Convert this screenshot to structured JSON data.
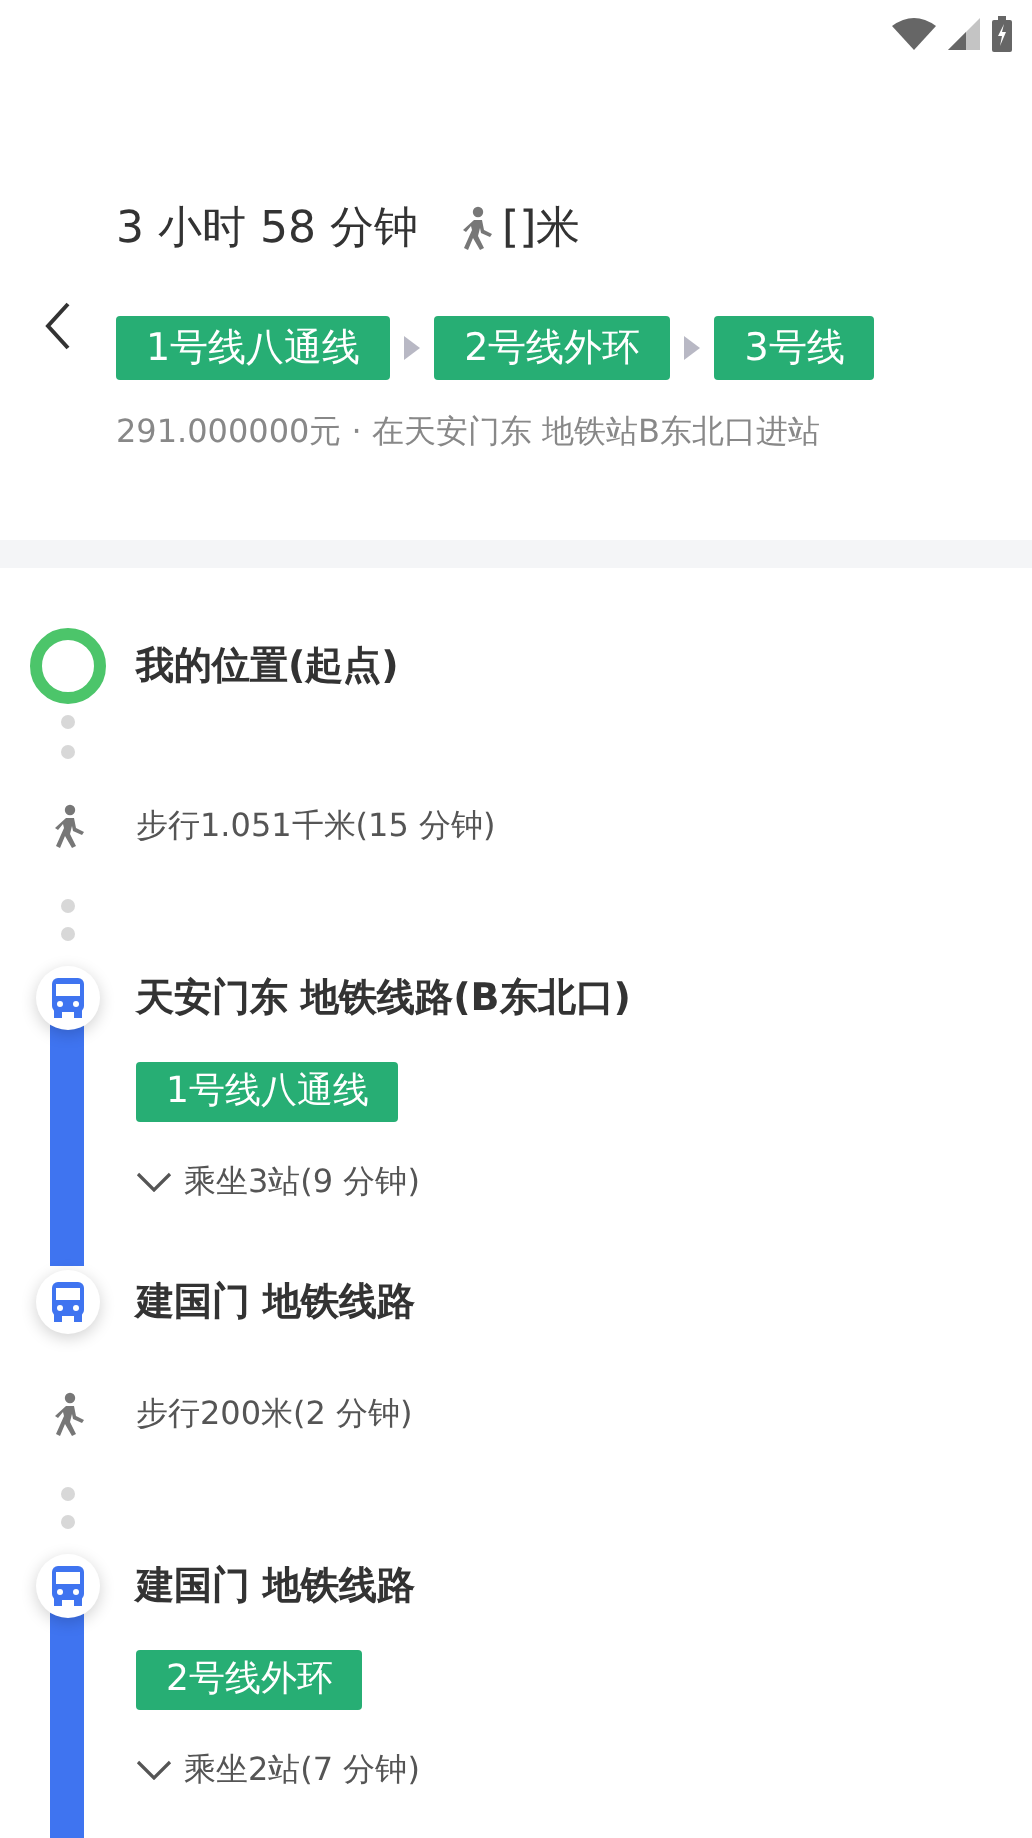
{
  "header": {
    "duration": "3 小时 58 分钟",
    "walk_distance": "[]米",
    "lines": [
      "1号线八通线",
      "2号线外环",
      "3号线"
    ],
    "summary": "291.000000元 · 在天安门东 地铁站B东北口进站"
  },
  "steps": [
    {
      "kind": "start",
      "title": "我的位置(起点)"
    },
    {
      "kind": "walk",
      "text": "步行1.051千米(15 分钟)"
    },
    {
      "kind": "station",
      "title": "天安门东 地铁线路(B东北口)",
      "line": "1号线八通线",
      "ride": "乘坐3站(9 分钟)"
    },
    {
      "kind": "station",
      "title": "建国门 地铁线路"
    },
    {
      "kind": "walk",
      "text": "步行200米(2 分钟)"
    },
    {
      "kind": "station",
      "title": "建国门 地铁线路",
      "line": "2号线外环",
      "ride": "乘坐2站(7 分钟)"
    }
  ]
}
